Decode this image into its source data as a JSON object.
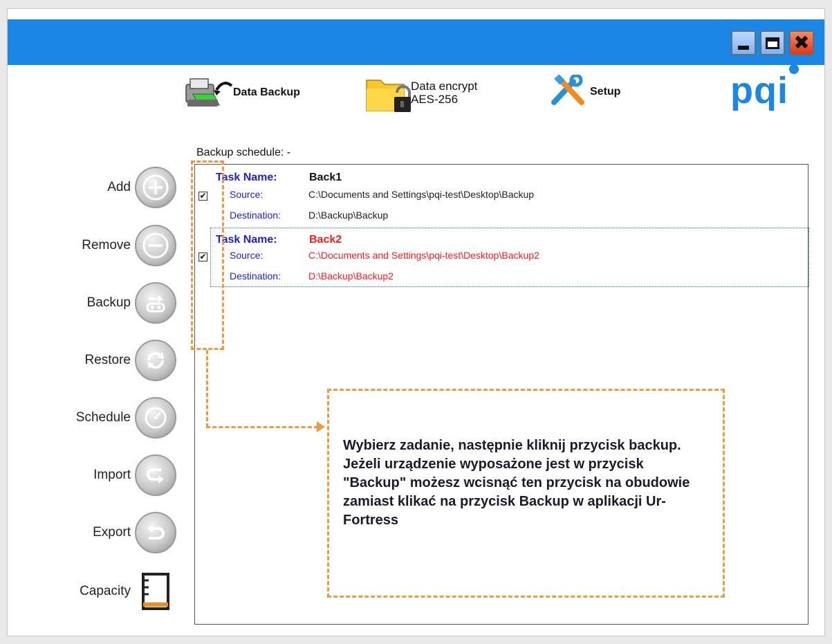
{
  "window": {
    "title_bar_color": "#1a86e6",
    "controls": [
      "minimize-icon",
      "maximize-icon",
      "close-icon"
    ]
  },
  "toolbar": {
    "data_backup_label": "Data Backup",
    "data_encrypt_label": "Data encrypt",
    "data_encrypt_sub": "AES-256",
    "setup_label": "Setup"
  },
  "logo": {
    "text": "pqi"
  },
  "schedule": {
    "title": "Backup schedule: -"
  },
  "sidebar": {
    "items": [
      {
        "label": "Add",
        "icon": "plus-icon"
      },
      {
        "label": "Remove",
        "icon": "minus-icon"
      },
      {
        "label": "Backup",
        "icon": "backup-icon"
      },
      {
        "label": "Restore",
        "icon": "restore-icon"
      },
      {
        "label": "Schedule",
        "icon": "clock-icon"
      },
      {
        "label": "Import",
        "icon": "import-icon"
      },
      {
        "label": "Export",
        "icon": "export-icon"
      },
      {
        "label": "Capacity",
        "icon": "capacity-icon"
      }
    ]
  },
  "tasks": [
    {
      "name_label": "Task Name:",
      "name": "Back1",
      "source_label": "Source:",
      "source": "C:\\Documents and Settings\\pqi-test\\Desktop\\Backup",
      "dest_label": "Destination:",
      "destination": "D:\\Backup\\Backup",
      "checked": true,
      "selected": false
    },
    {
      "name_label": "Task Name:",
      "name": "Back2",
      "source_label": "Source:",
      "source": "C:\\Documents and Settings\\pqi-test\\Desktop\\Backup2",
      "dest_label": "Destination:",
      "destination": "D:\\Backup\\Backup2",
      "checked": true,
      "selected": true
    }
  ],
  "callout": {
    "text": "Wybierz zadanie, następnie kliknij przycisk backup. Jeżeli urządzenie wyposażone jest w przycisk \"Backup\" możesz wcisnąć ten przycisk na obudowie zamiast klikać na przycisk Backup w aplikacji Ur-Fortress",
    "color": "#f09a3e"
  }
}
